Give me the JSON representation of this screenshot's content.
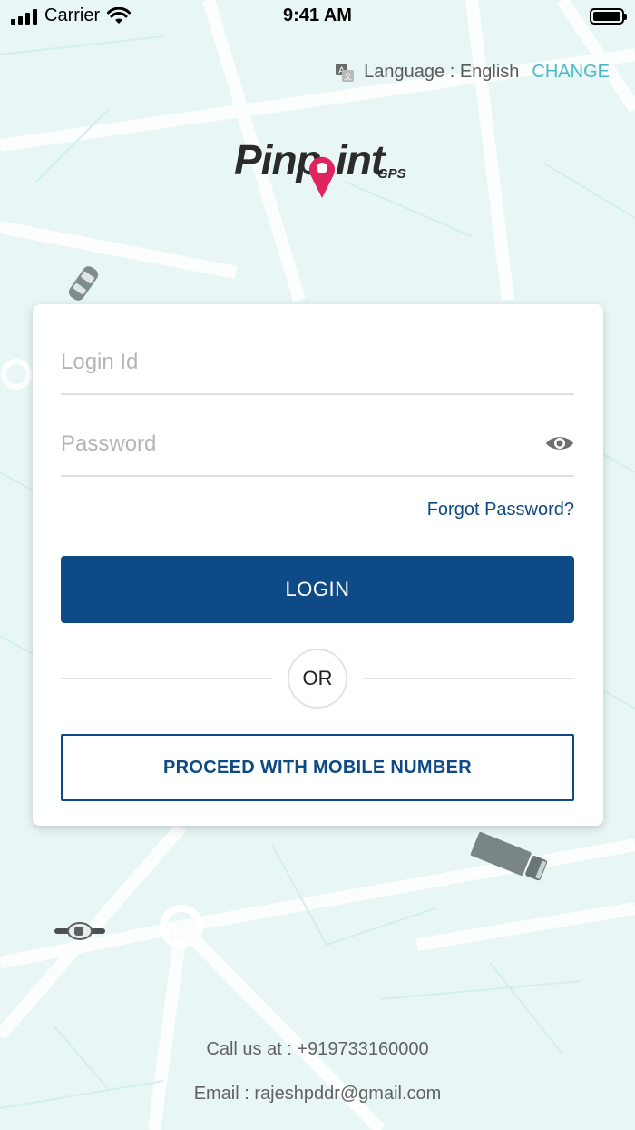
{
  "status_bar": {
    "carrier": "Carrier",
    "time": "9:41 AM"
  },
  "language": {
    "icon": "translate-icon",
    "text": "Language : English",
    "change_label": "CHANGE"
  },
  "logo": {
    "text": "Pinpoint",
    "suffix": "GPS"
  },
  "login_form": {
    "login_id_placeholder": "Login Id",
    "password_placeholder": "Password",
    "password_toggle_icon": "eye-icon",
    "forgot_password": "Forgot Password?",
    "login_button": "LOGIN",
    "or_text": "OR",
    "mobile_button": "PROCEED WITH MOBILE NUMBER"
  },
  "footer": {
    "call": "Call us at : +919733160000",
    "email": "Email : rajeshpddr@gmail.com"
  },
  "colors": {
    "primary": "#0e4a85",
    "accent": "#4bb8c6",
    "logo_pin": "#e0245e",
    "map_background": "#e8f6f6"
  }
}
